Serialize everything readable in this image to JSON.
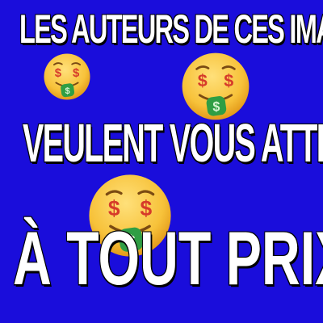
{
  "meme": {
    "line1": "LES AUTEURS DE CES IMAGES",
    "line2": "VEULENT VOUS ATTIRER",
    "line3": "À TOUT PRIX"
  },
  "emojis": [
    {
      "icon": "money-mouth-face-icon"
    },
    {
      "icon": "money-mouth-face-icon"
    },
    {
      "icon": "money-mouth-face-icon"
    }
  ],
  "colors": {
    "background": "#1a0ddb",
    "text": "#ffffff",
    "emoji_face": "#f7c23a",
    "dollar": "#d63a2a",
    "money_green": "#2f9e44"
  }
}
